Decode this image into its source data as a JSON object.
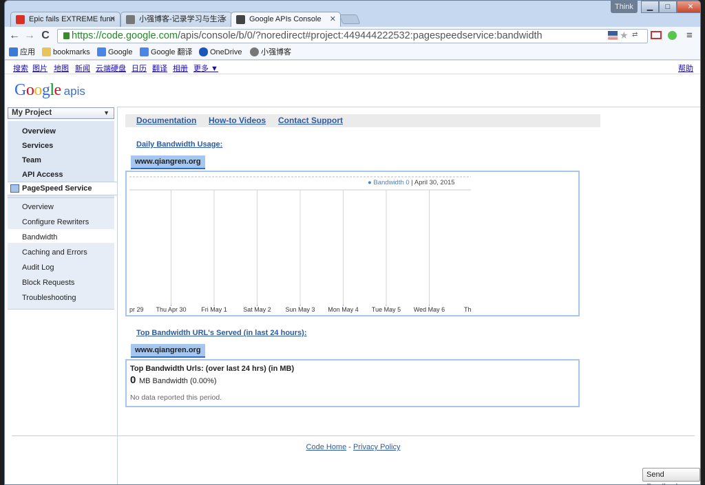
{
  "window": {
    "title_tag": "Think",
    "min": "▁",
    "max": "□",
    "close": "✕"
  },
  "tabs": [
    {
      "label": "Epic fails EXTREME funn",
      "fav_color": "#d93025"
    },
    {
      "label": "小强博客-记录学习与生活",
      "fav_color": "#777777"
    },
    {
      "label": "Google APIs Console",
      "fav_color": "#444444"
    }
  ],
  "nav": {
    "back": "←",
    "forward": "→",
    "reload": "C"
  },
  "address": {
    "secure_part": "https://code.google.com",
    "rest": "/apis/console/b/0/?noredirect#project:449444222532:pagespeedservice:bandwidth"
  },
  "toolbar_icons": {
    "star": "★",
    "translate": "⇄",
    "menu": "≡"
  },
  "bookmarks": [
    {
      "label": "应用",
      "color": "#3b7bd8"
    },
    {
      "label": "bookmarks",
      "color": "#e8c45a"
    },
    {
      "label": "Google",
      "color": "#4a86e8"
    },
    {
      "label": "Google 翻译",
      "color": "#4a86e8"
    },
    {
      "label": "OneDrive",
      "color": "#1b57b8"
    },
    {
      "label": "小强博客",
      "color": "#777777"
    }
  ],
  "gbar": {
    "links": [
      "搜索",
      "图片",
      "地图",
      "新闻",
      "云端硬盘",
      "日历",
      "翻译",
      "相册",
      "更多 ▼"
    ],
    "help": "帮助"
  },
  "logo": {
    "google": "Google",
    "apis": "apis",
    "colors": [
      "#3369e8",
      "#d50f25",
      "#eeb211",
      "#3369e8",
      "#009925",
      "#d50f25"
    ]
  },
  "sidebar": {
    "project": "My Project",
    "project_arrow": "▼",
    "items": [
      "Overview",
      "Services",
      "Team",
      "API Access"
    ],
    "service": "PageSpeed Service",
    "sub_items": [
      "Overview",
      "Configure Rewriters",
      "Bandwidth",
      "Caching and Errors",
      "Audit Log",
      "Block Requests",
      "Troubleshooting"
    ],
    "selected_sub": "Bandwidth"
  },
  "links": {
    "documentation": "Documentation",
    "howto": "How-to Videos",
    "support": "Contact Support"
  },
  "daily": {
    "title": "Daily Bandwidth Usage:",
    "domain": "www.qiangren.org"
  },
  "chart_data": {
    "type": "line",
    "x": [
      "pr 29",
      "Thu Apr 30",
      "Fri May 1",
      "Sat May 2",
      "Sun May 3",
      "Mon May 4",
      "Tue May 5",
      "Wed May 6",
      "Thu M"
    ],
    "series": [
      {
        "name": "Bandwidth",
        "values": [
          0,
          0,
          0,
          0,
          0,
          0,
          0,
          0,
          0
        ]
      }
    ],
    "legend": {
      "dot": "●",
      "series": "Bandwidth 0",
      "sep": "|",
      "date": "April 30, 2015"
    },
    "grid": true,
    "legend_position": "top-right",
    "series_color": "#4a7fd1"
  },
  "top": {
    "title": "Top Bandwidth URL's Served (in last 24 hours):",
    "domain": "www.qiangren.org",
    "box_title": "Top Bandwidth Urls: (over last 24 hrs) (in MB)",
    "zero": "0",
    "mb": "MB Bandwidth (0.00%)",
    "nodata": "No data reported this period."
  },
  "footer": {
    "home": "Code Home",
    "sep": " - ",
    "privacy": "Privacy Policy"
  },
  "feedback": "Send Feedback"
}
